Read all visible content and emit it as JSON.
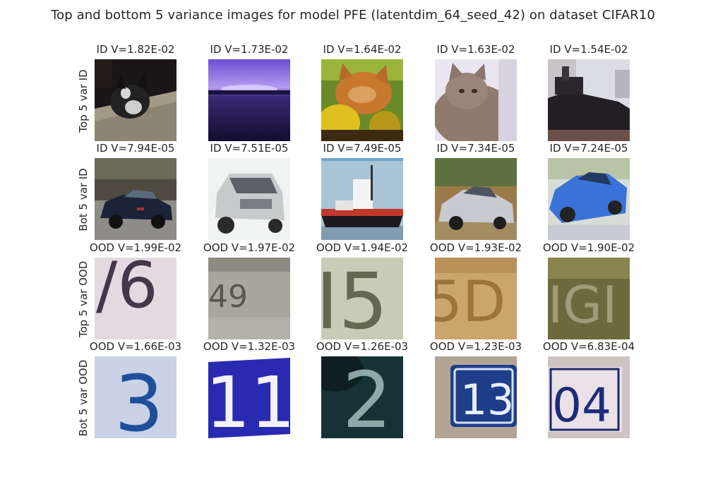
{
  "title": "Top and bottom 5 variance images for model PFE (latentdim_64_seed_42) on dataset CIFAR10",
  "rows": [
    {
      "label": "Top 5 var ID",
      "images": [
        {
          "caption": "ID V=1.82E-02",
          "subject": "cat-icon"
        },
        {
          "caption": "ID V=1.73E-02",
          "subject": "landscape-icon"
        },
        {
          "caption": "ID V=1.64E-02",
          "subject": "cat-icon"
        },
        {
          "caption": "ID V=1.63E-02",
          "subject": "cat-icon"
        },
        {
          "caption": "ID V=1.54E-02",
          "subject": "ship-icon"
        }
      ]
    },
    {
      "label": "Bot 5 var ID",
      "images": [
        {
          "caption": "ID V=7.94E-05",
          "subject": "car-icon"
        },
        {
          "caption": "ID V=7.51E-05",
          "subject": "car-icon"
        },
        {
          "caption": "ID V=7.49E-05",
          "subject": "ship-icon"
        },
        {
          "caption": "ID V=7.34E-05",
          "subject": "car-icon"
        },
        {
          "caption": "ID V=7.24E-05",
          "subject": "car-icon"
        }
      ]
    },
    {
      "label": "Top 5 var OOD",
      "images": [
        {
          "caption": "OOD V=1.99E-02",
          "subject": "house-number-icon"
        },
        {
          "caption": "OOD V=1.97E-02",
          "subject": "house-number-icon"
        },
        {
          "caption": "OOD V=1.94E-02",
          "subject": "house-number-icon"
        },
        {
          "caption": "OOD V=1.93E-02",
          "subject": "house-number-icon"
        },
        {
          "caption": "OOD V=1.90E-02",
          "subject": "house-number-icon"
        }
      ]
    },
    {
      "label": "Bot 5 var OOD",
      "images": [
        {
          "caption": "OOD V=1.66E-03",
          "subject": "house-number-icon"
        },
        {
          "caption": "OOD V=1.32E-03",
          "subject": "house-number-icon"
        },
        {
          "caption": "OOD V=1.26E-03",
          "subject": "house-number-icon"
        },
        {
          "caption": "OOD V=1.23E-03",
          "subject": "house-number-icon"
        },
        {
          "caption": "OOD V=6.83E-04",
          "subject": "house-number-icon"
        }
      ]
    }
  ]
}
